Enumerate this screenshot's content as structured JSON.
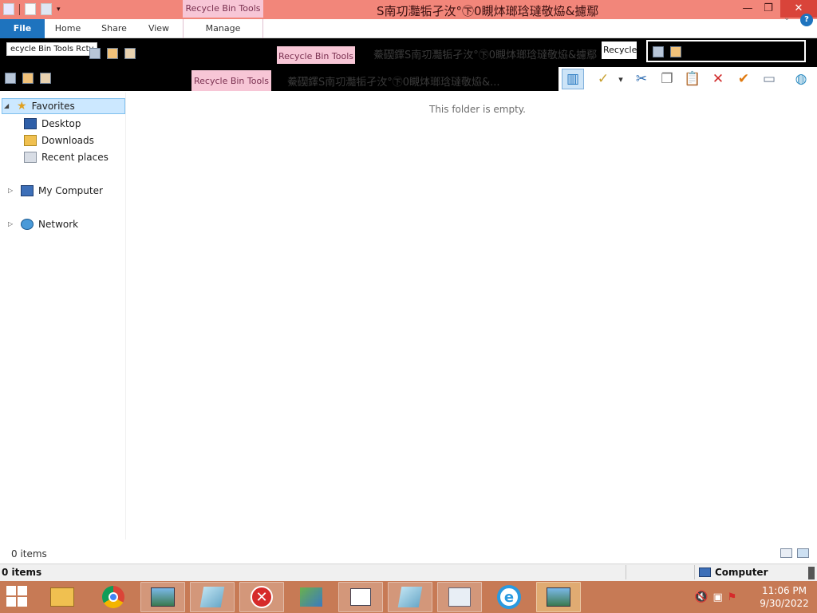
{
  "window": {
    "title": "S南㓛灩㸸孑㳊°㊦0瞡㶱瑯琀㼀敬㶸&攄鄢",
    "context_tab": "Recycle Bin Tools",
    "controls": {
      "minimize": "—",
      "restore": "❐",
      "close": "✕"
    }
  },
  "ribbon": {
    "tabs": [
      {
        "label": "File"
      },
      {
        "label": "Home"
      },
      {
        "label": "Share"
      },
      {
        "label": "View"
      },
      {
        "label": "Manage"
      }
    ],
    "help_chevron": "⌄",
    "help": "?"
  },
  "glitch": {
    "label1": "ecycle Bin Tools",
    "label1b": "Rcty",
    "context_tab1": "Recycle Bin Tools",
    "title1": "鯗碶⃞鐸S南㓛灩㸸孑㳊°㊦0瞡㶱瑯琀㼀敬㶸&攄鄢",
    "box_text": "Recycle",
    "context_tab2": "Recycle Bin Tools",
    "title2": "鯗碶⃞鐸S南㓛灩㸸孑㳊°㊦0瞡㶱瑯琀㼀敬㶸&..."
  },
  "toolbar": {
    "layout": "▥",
    "properties": "✓",
    "dropdown": "▾",
    "cut": "✂",
    "copy": "❐",
    "paste": "📋",
    "delete": "✕",
    "check": "✔",
    "rename": "▭",
    "globe": "◍"
  },
  "navigation": {
    "favorites": "Favorites",
    "desktop": "Desktop",
    "downloads": "Downloads",
    "recent": "Recent places",
    "computer": "My Computer",
    "network": "Network"
  },
  "content": {
    "empty_message": "This folder is empty."
  },
  "status": {
    "items": "0 items",
    "bottom_items": "0 items",
    "location": "Computer"
  },
  "taskbar": {
    "time": "11:06 PM",
    "date": "9/30/2022"
  },
  "colors": {
    "titlebar": "#f2867a",
    "context_tab": "#f7c6d6",
    "file_tab": "#1e73be",
    "selection": "#cce8ff",
    "taskbar": "#c77a55"
  }
}
